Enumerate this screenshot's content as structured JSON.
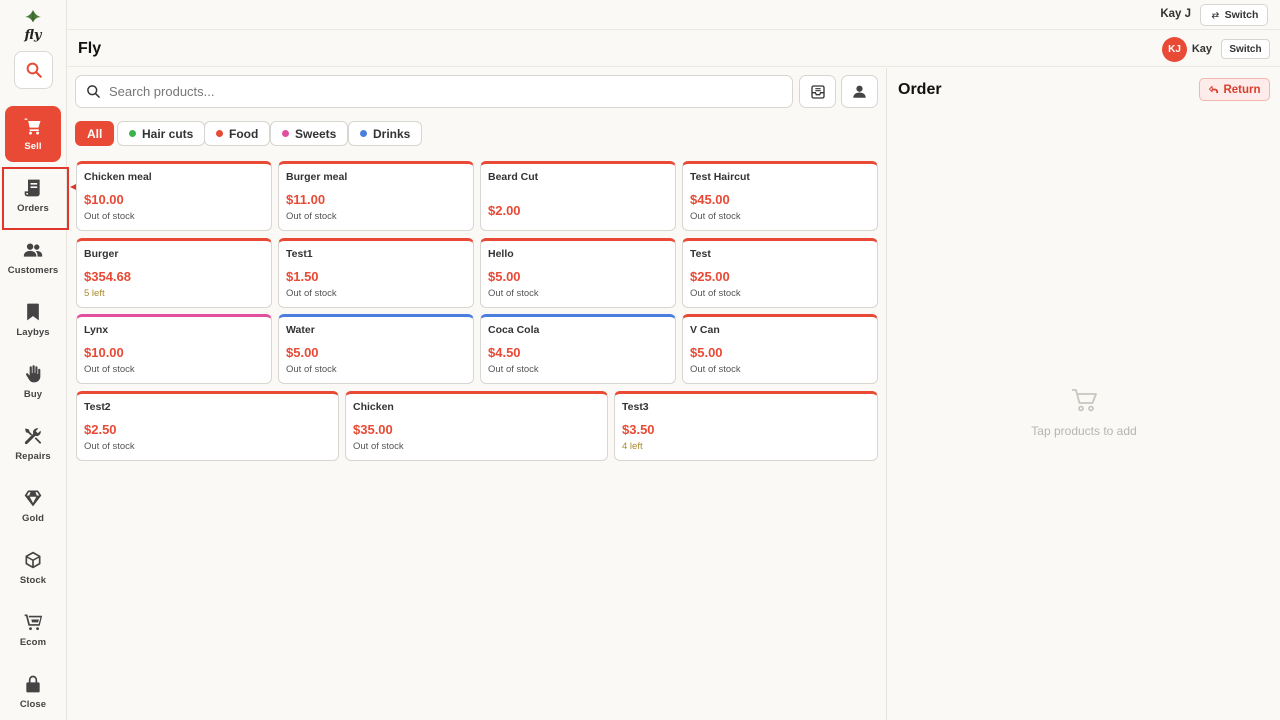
{
  "colors": {
    "accent": "#e84a36",
    "page_bg": "#fbf9f6"
  },
  "top_bar": {
    "user": "Kay J",
    "switch_label": "Switch"
  },
  "header": {
    "app_title": "Fly",
    "avatar_initials": "KJ",
    "user": "Kay",
    "switch_label": "Switch"
  },
  "sidebar": {
    "logo_text": "fly",
    "items": [
      {
        "label": "Sell",
        "icon": "cart-icon",
        "active": true
      },
      {
        "label": "Orders",
        "icon": "receipt-icon",
        "active": false
      },
      {
        "label": "Customers",
        "icon": "people-icon",
        "active": false
      },
      {
        "label": "Laybys",
        "icon": "bookmark-icon",
        "active": false
      },
      {
        "label": "Buy",
        "icon": "hand-icon",
        "active": false
      },
      {
        "label": "Repairs",
        "icon": "tools-icon",
        "active": false
      },
      {
        "label": "Gold",
        "icon": "diamond-icon",
        "active": false
      },
      {
        "label": "Stock",
        "icon": "box-icon",
        "active": false
      },
      {
        "label": "Ecom",
        "icon": "cart-outline-icon",
        "active": false
      },
      {
        "label": "Close",
        "icon": "lock-icon",
        "active": false
      }
    ]
  },
  "search": {
    "placeholder": "Search products..."
  },
  "categories": [
    {
      "label": "All",
      "color": "",
      "active": true
    },
    {
      "label": "Hair cuts",
      "color": "#3bb34a",
      "active": false
    },
    {
      "label": "Food",
      "color": "#e84a36",
      "active": false
    },
    {
      "label": "Sweets",
      "color": "#e0509e",
      "active": false
    },
    {
      "label": "Drinks",
      "color": "#4a7fe0",
      "active": false
    }
  ],
  "products": [
    {
      "name": "Chicken meal",
      "price": "$10.00",
      "stock": "Out of stock",
      "color": "#e84a36"
    },
    {
      "name": "Burger meal",
      "price": "$11.00",
      "stock": "Out of stock",
      "color": "#e84a36"
    },
    {
      "name": "Beard Cut",
      "price": "$2.00",
      "stock": "",
      "color": "#e84a36"
    },
    {
      "name": "Test Haircut",
      "price": "$45.00",
      "stock": "Out of stock",
      "color": "#e84a36"
    },
    {
      "name": "Burger",
      "price": "$354.68",
      "stock": "5 left",
      "color": "#e84a36"
    },
    {
      "name": "Test1",
      "price": "$1.50",
      "stock": "Out of stock",
      "color": "#e84a36"
    },
    {
      "name": "Hello",
      "price": "$5.00",
      "stock": "Out of stock",
      "color": "#e84a36"
    },
    {
      "name": "Test",
      "price": "$25.00",
      "stock": "Out of stock",
      "color": "#e84a36"
    },
    {
      "name": "Lynx",
      "price": "$10.00",
      "stock": "Out of stock",
      "color": "#e0509e"
    },
    {
      "name": "Water",
      "price": "$5.00",
      "stock": "Out of stock",
      "color": "#4a7fe0"
    },
    {
      "name": "Coca Cola",
      "price": "$4.50",
      "stock": "Out of stock",
      "color": "#4a7fe0"
    },
    {
      "name": "V Can",
      "price": "$5.00",
      "stock": "Out of stock",
      "color": "#e84a36"
    },
    {
      "name": "Test2",
      "price": "$2.50",
      "stock": "Out of stock",
      "color": "#e84a36"
    },
    {
      "name": "Chicken",
      "price": "$35.00",
      "stock": "Out of stock",
      "color": "#e84a36"
    },
    {
      "name": "Test3",
      "price": "$3.50",
      "stock": "4 left",
      "color": "#e84a36"
    }
  ],
  "order": {
    "title": "Order",
    "return_label": "Return",
    "empty_text": "Tap products to add"
  }
}
